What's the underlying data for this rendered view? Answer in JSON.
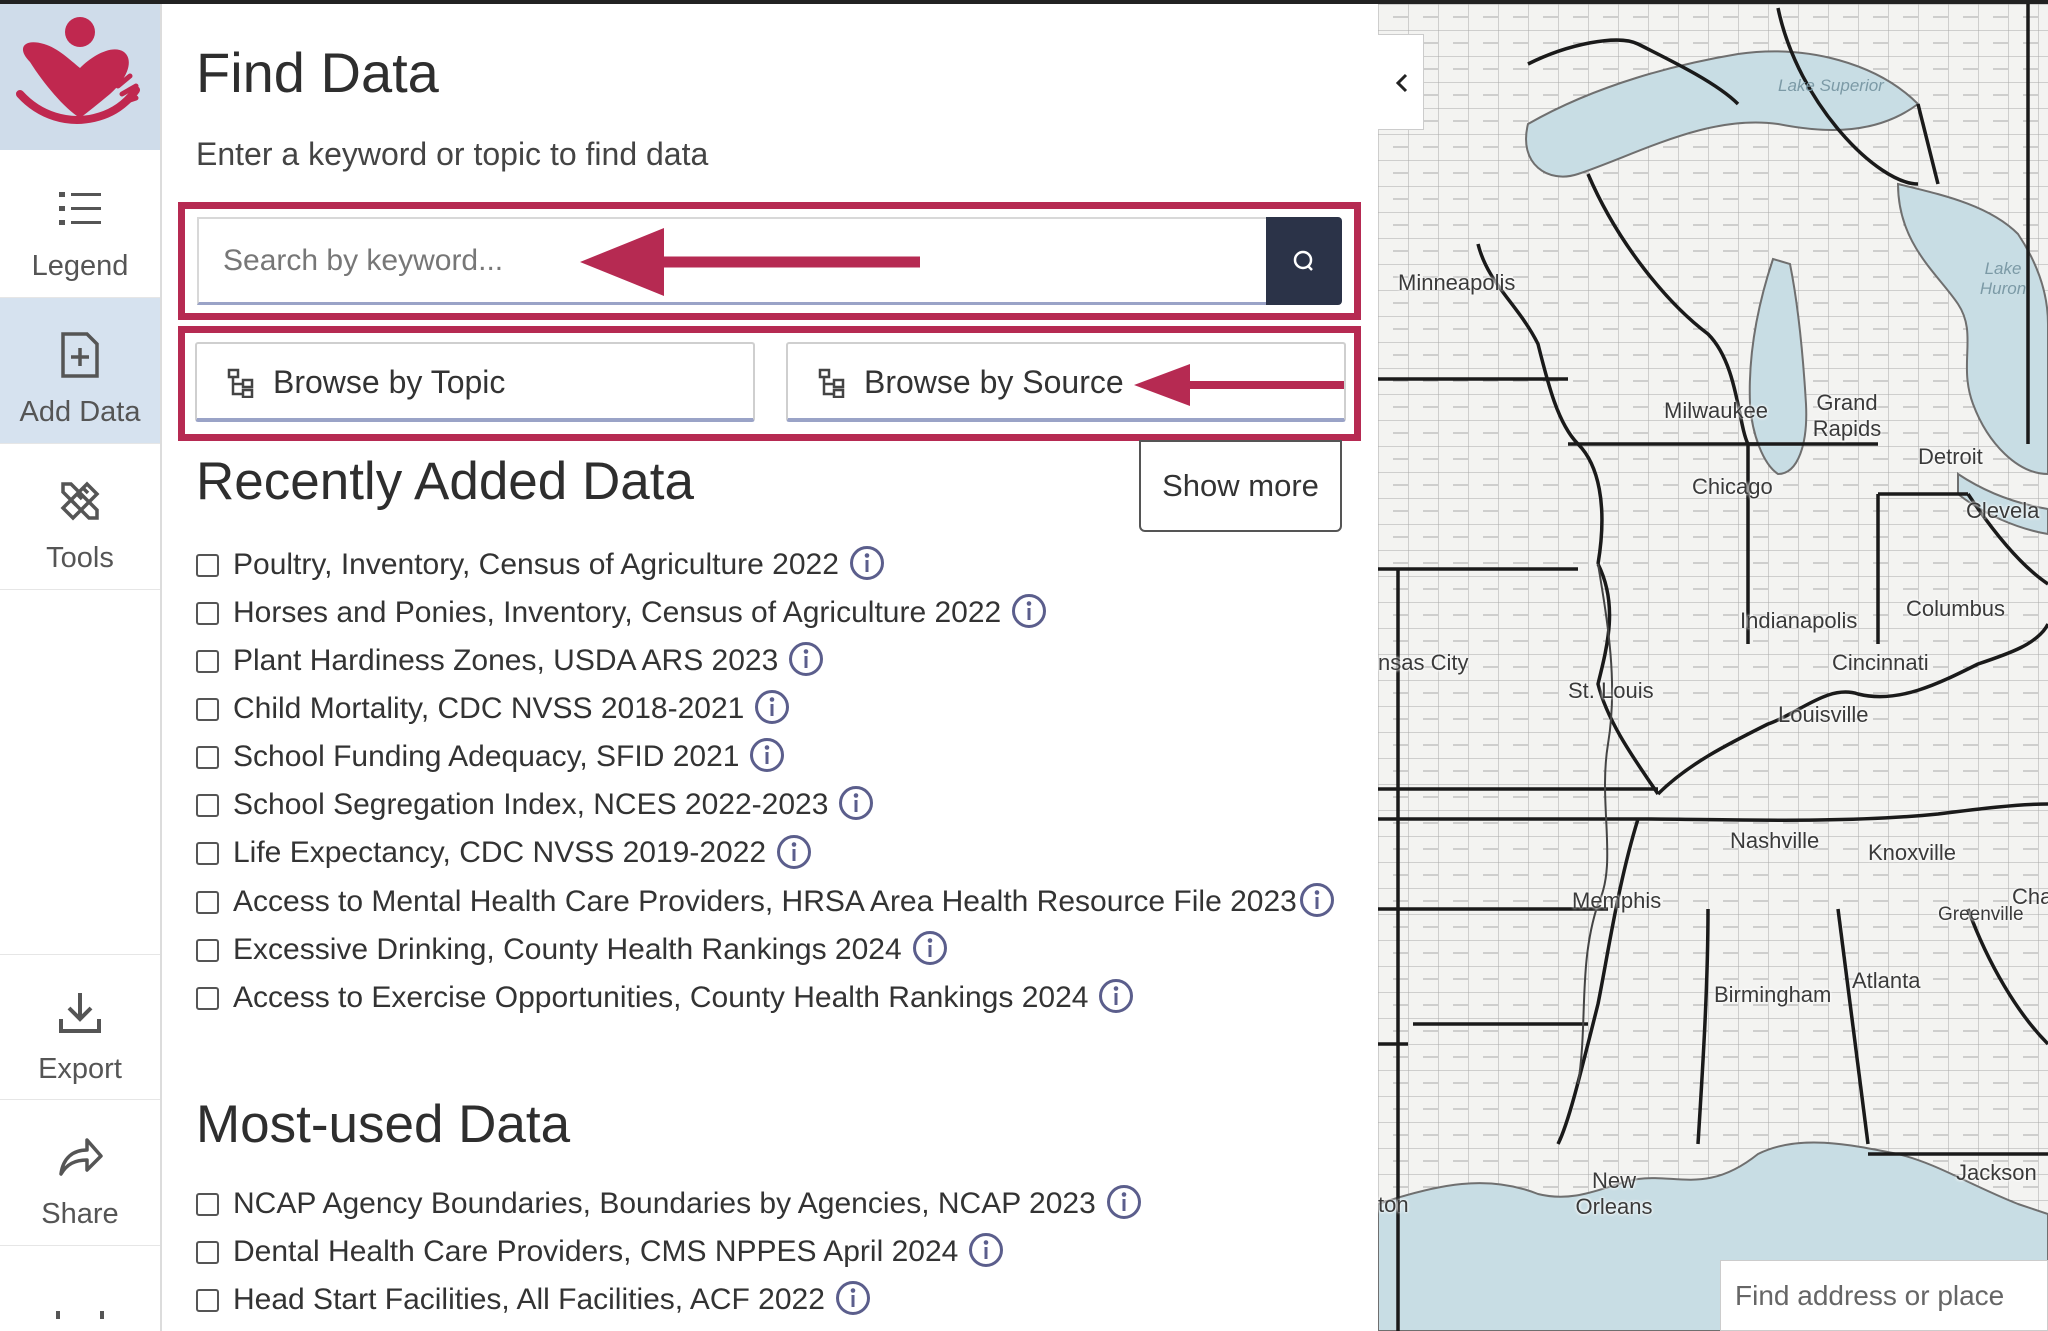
{
  "accent_color": "#b62a52",
  "nav": {
    "logo": "heart-hands-logo",
    "items": [
      {
        "label": "Legend",
        "icon": "list-icon"
      },
      {
        "label": "Add Data",
        "icon": "add-file-icon"
      },
      {
        "label": "Tools",
        "icon": "ruler-pencil-icon"
      },
      {
        "label": "Export",
        "icon": "download-icon"
      },
      {
        "label": "Share",
        "icon": "share-arrow-icon"
      }
    ]
  },
  "panel": {
    "title": "Find Data",
    "subtitle": "Enter a keyword or topic to find data",
    "search": {
      "placeholder": "Search by keyword...",
      "value": ""
    },
    "browse_topic": "Browse by Topic",
    "browse_source": "Browse by Source",
    "recent_heading": "Recently Added Data",
    "show_more": "Show more",
    "recent": [
      "Poultry, Inventory, Census of Agriculture 2022",
      "Horses and Ponies, Inventory, Census of Agriculture 2022",
      "Plant Hardiness Zones, USDA ARS 2023",
      "Child Mortality, CDC NVSS 2018-2021",
      "School Funding Adequacy, SFID 2021",
      "School Segregation Index, NCES 2022-2023",
      "Life Expectancy, CDC NVSS 2019-2022",
      "Access to Mental Health Care Providers, HRSA Area Health Resource File 2023",
      "Excessive Drinking, County Health Rankings 2024",
      "Access to Exercise Opportunities, County Health Rankings 2024"
    ],
    "most_heading": "Most-used Data",
    "most": [
      "NCAP Agency Boundaries, Boundaries by Agencies, NCAP 2023",
      "Dental Health Care Providers, CMS NPPES April 2024",
      "Head Start Facilities, All Facilities, ACF 2022"
    ]
  },
  "map": {
    "cities": [
      "Minneapolis",
      "Milwaukee",
      "Grand Rapids",
      "Detroit",
      "Chicago",
      "Clevela",
      "Indianapolis",
      "Columbus",
      "nsas City",
      "Cincinnati",
      "St. Louis",
      "Louisville",
      "Nashville",
      "Knoxville",
      "Cha",
      "Memphis",
      "Greenville",
      "Birmingham",
      "Atlanta",
      "Jackson",
      "ton",
      "New Orleans"
    ],
    "lakes": [
      "Lake Superior",
      "Lake Huron"
    ],
    "find_placeholder": "Find address or place"
  }
}
